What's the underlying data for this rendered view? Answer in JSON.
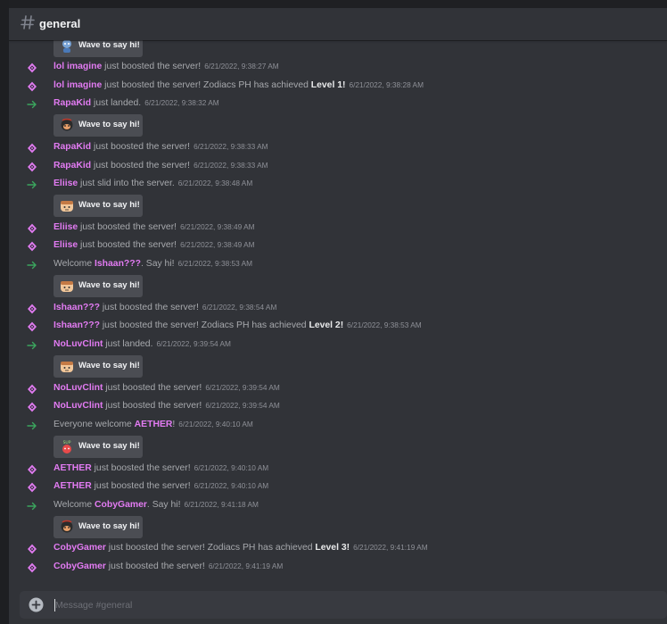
{
  "channel": {
    "name": "general"
  },
  "composer": {
    "placeholder": "Message #general"
  },
  "wave_label": "Wave to say hi!",
  "colors": {
    "boost": "#e27bf2",
    "join": "#3ba55d"
  },
  "messages": [
    {
      "type": "boost",
      "name": "lol imagine",
      "text": " just boosted the server!",
      "timestamp": "6/21/2022, 9:38:27 AM"
    },
    {
      "type": "boost",
      "name": "lol imagine",
      "text": " just boosted the server! Zodiacs PH has achieved ",
      "level": "Level 1!",
      "timestamp": "6/21/2022, 9:38:28 AM"
    },
    {
      "type": "join",
      "name": "RapaKid",
      "text": " just landed.",
      "timestamp": "6/21/2022, 9:38:32 AM"
    },
    {
      "type": "boost",
      "name": "RapaKid",
      "text": " just boosted the server!",
      "timestamp": "6/21/2022, 9:38:33 AM"
    },
    {
      "type": "boost",
      "name": "RapaKid",
      "text": " just boosted the server!",
      "timestamp": "6/21/2022, 9:38:33 AM"
    },
    {
      "type": "join",
      "name": "Eliise",
      "text": " just slid into the server.",
      "timestamp": "6/21/2022, 9:38:48 AM"
    },
    {
      "type": "boost",
      "name": "Eliise",
      "text": " just boosted the server!",
      "timestamp": "6/21/2022, 9:38:49 AM"
    },
    {
      "type": "boost",
      "name": "Eliise",
      "text": " just boosted the server!",
      "timestamp": "6/21/2022, 9:38:49 AM"
    },
    {
      "type": "join",
      "prefix": "Welcome ",
      "name": "Ishaan???",
      "text": ". Say hi!",
      "timestamp": "6/21/2022, 9:38:53 AM"
    },
    {
      "type": "boost",
      "name": "Ishaan???",
      "text": " just boosted the server!",
      "timestamp": "6/21/2022, 9:38:54 AM"
    },
    {
      "type": "boost",
      "name": "Ishaan???",
      "text": " just boosted the server! Zodiacs PH has achieved ",
      "level": "Level 2!",
      "timestamp": "6/21/2022, 9:38:53 AM"
    },
    {
      "type": "join",
      "name": "NoLuvClint",
      "text": " just landed.",
      "timestamp": "6/21/2022, 9:39:54 AM"
    },
    {
      "type": "boost",
      "name": "NoLuvClint",
      "text": " just boosted the server!",
      "timestamp": "6/21/2022, 9:39:54 AM"
    },
    {
      "type": "boost",
      "name": "NoLuvClint",
      "text": " just boosted the server!",
      "timestamp": "6/21/2022, 9:39:54 AM"
    },
    {
      "type": "join",
      "prefix": "Everyone welcome ",
      "name": "AETHER",
      "text": "!",
      "timestamp": "6/21/2022, 9:40:10 AM"
    },
    {
      "type": "boost",
      "name": "AETHER",
      "text": " just boosted the server!",
      "timestamp": "6/21/2022, 9:40:10 AM"
    },
    {
      "type": "boost",
      "name": "AETHER",
      "text": " just boosted the server!",
      "timestamp": "6/21/2022, 9:40:10 AM"
    },
    {
      "type": "join",
      "prefix": "Welcome ",
      "name": "CobyGamer",
      "text": ". Say hi!",
      "timestamp": "6/21/2022, 9:41:18 AM"
    },
    {
      "type": "boost",
      "name": "CobyGamer",
      "text": " just boosted the server! Zodiacs PH has achieved ",
      "level": "Level 3!",
      "timestamp": "6/21/2022, 9:41:19 AM"
    },
    {
      "type": "boost",
      "name": "CobyGamer",
      "text": " just boosted the server!",
      "timestamp": "6/21/2022, 9:41:19 AM"
    }
  ]
}
